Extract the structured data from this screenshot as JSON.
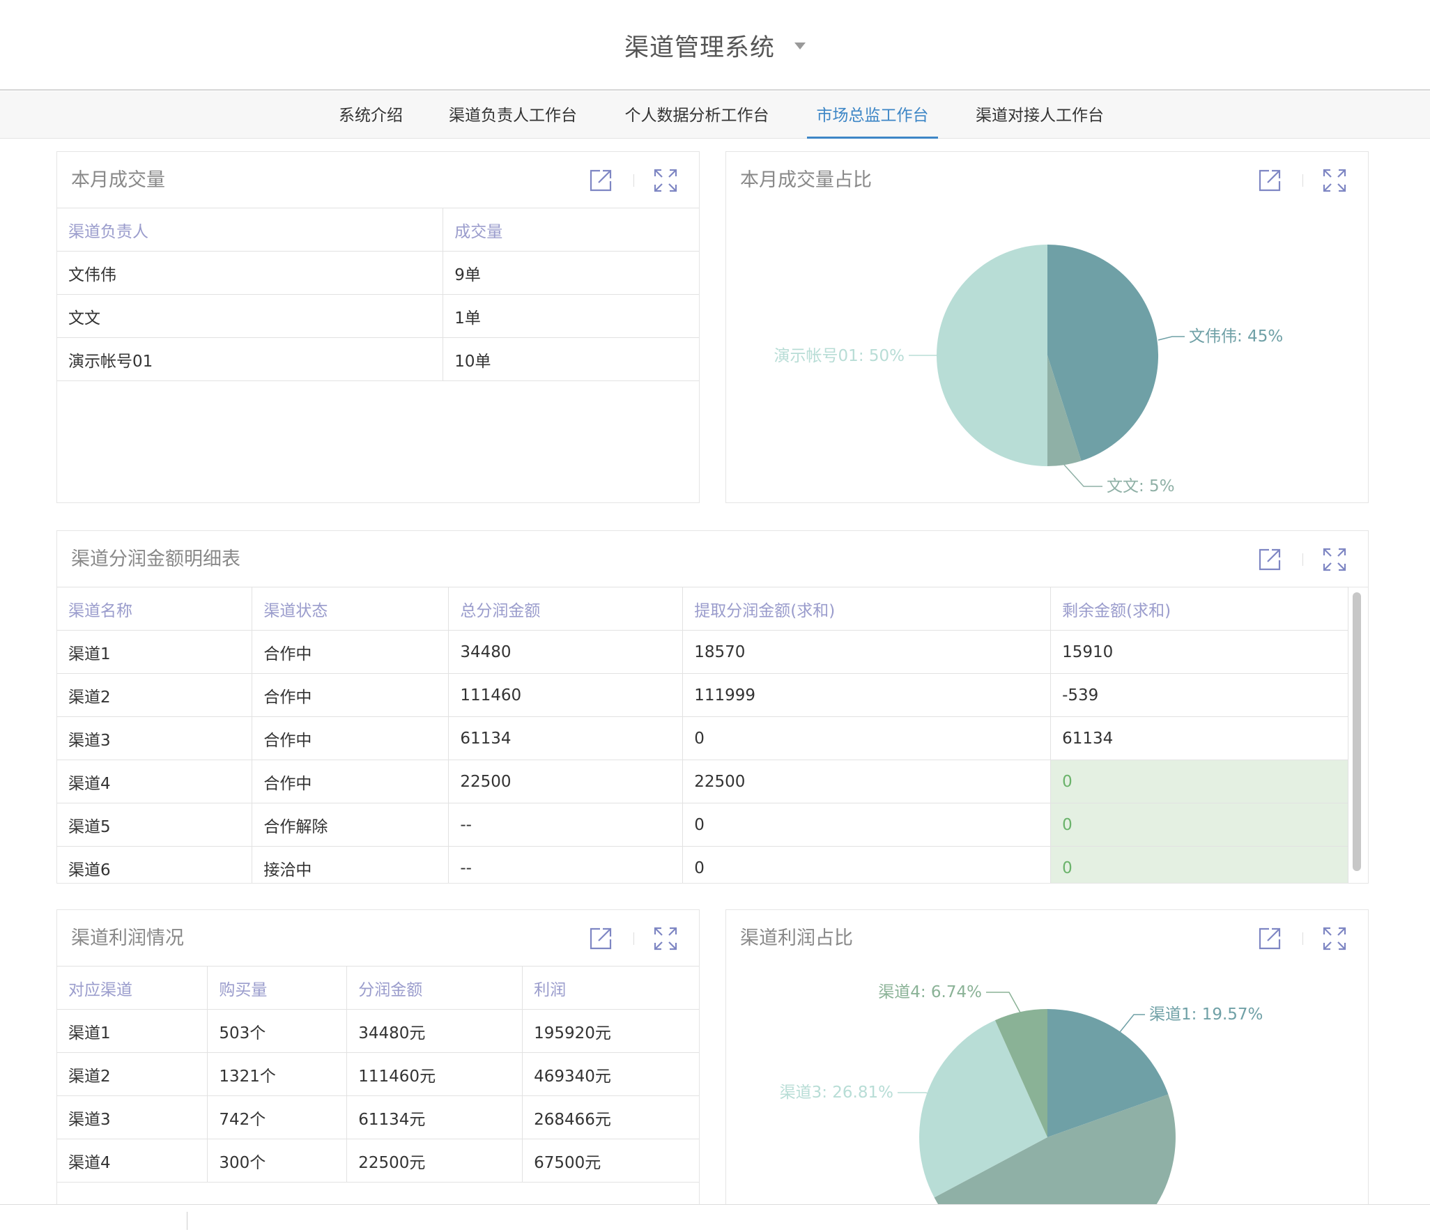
{
  "app": {
    "title": "渠道管理系统"
  },
  "nav": {
    "tabs": [
      {
        "label": "系统介绍"
      },
      {
        "label": "渠道负责人工作台"
      },
      {
        "label": "个人数据分析工作台"
      },
      {
        "label": "市场总监工作台",
        "active": true
      },
      {
        "label": "渠道对接人工作台"
      }
    ]
  },
  "panels": {
    "monthly_volume": {
      "title": "本月成交量",
      "columns": [
        "渠道负责人",
        "成交量"
      ],
      "rows": [
        [
          "文伟伟",
          "9单"
        ],
        [
          "文文",
          "1单"
        ],
        [
          "演示帐号01",
          "10单"
        ]
      ]
    },
    "monthly_share": {
      "title": "本月成交量占比",
      "labels": [
        "文伟伟: 45%",
        "文文: 5%",
        "演示帐号01: 50%"
      ]
    },
    "profit_detail": {
      "title": "渠道分润金额明细表",
      "columns": [
        "渠道名称",
        "渠道状态",
        "总分润金额",
        "提取分润金额(求和)",
        "剩余金额(求和)"
      ],
      "rows": [
        [
          "渠道1",
          "合作中",
          "34480",
          "18570",
          "15910"
        ],
        [
          "渠道2",
          "合作中",
          "111460",
          "111999",
          "-539"
        ],
        [
          "渠道3",
          "合作中",
          "61134",
          "0",
          "61134"
        ],
        [
          "渠道4",
          "合作中",
          "22500",
          "22500",
          "0"
        ],
        [
          "渠道5",
          "合作解除",
          "--",
          "0",
          "0"
        ],
        [
          "渠道6",
          "接洽中",
          "--",
          "0",
          "0"
        ]
      ]
    },
    "channel_profit": {
      "title": "渠道利润情况",
      "columns": [
        "对应渠道",
        "购买量",
        "分润金额",
        "利润"
      ],
      "rows": [
        [
          "渠道1",
          "503个",
          "34480元",
          "195920元"
        ],
        [
          "渠道2",
          "1321个",
          "111460元",
          "469340元"
        ],
        [
          "渠道3",
          "742个",
          "61134元",
          "268466元"
        ],
        [
          "渠道4",
          "300个",
          "22500元",
          "67500元"
        ]
      ]
    },
    "profit_share": {
      "title": "渠道利润占比",
      "labels": [
        "渠道1: 19.57%",
        "渠道3: 26.81%",
        "渠道4: 6.74%"
      ]
    }
  },
  "chart_data": [
    {
      "type": "pie",
      "categories": [
        "文伟伟",
        "文文",
        "演示帐号01"
      ],
      "values": [
        45,
        5,
        50
      ],
      "colors": [
        "#6fa0a6",
        "#8fb0a6",
        "#b8ddd6"
      ]
    },
    {
      "type": "pie",
      "categories": [
        "渠道1",
        "渠道2",
        "渠道3",
        "渠道4"
      ],
      "values": [
        19.57,
        46.88,
        26.81,
        6.74
      ],
      "colors": [
        "#6fa0a6",
        "#8fb0a6",
        "#b8ddd6",
        "#8ab296"
      ]
    }
  ]
}
